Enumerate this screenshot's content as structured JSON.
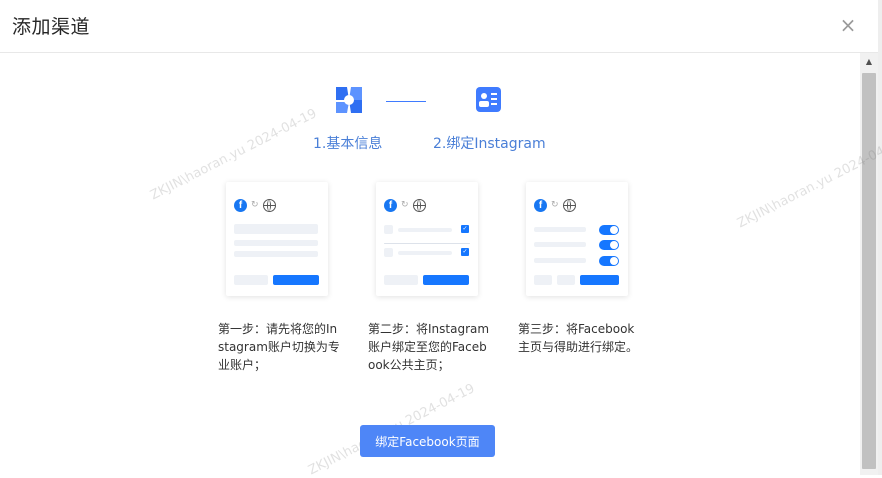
{
  "dialog": {
    "title": "添加渠道",
    "close_glyph": "×"
  },
  "steps": [
    {
      "label": "1.基本信息",
      "icon": "bowtie-shapes-icon"
    },
    {
      "label": "2.绑定Instagram",
      "icon": "profile-card-icon"
    }
  ],
  "cards": [
    {
      "description": "第一步：请先将您的Instagram账户切换为专业账户；"
    },
    {
      "description": "第二步：将Instagram账户绑定至您的Facebook公共主页；"
    },
    {
      "description": "第三步：将Facebook主页与得助进行绑定。"
    }
  ],
  "action": {
    "label": "绑定Facebook页面"
  },
  "watermark": {
    "text": "ZKJIN\\haoran.yu  2024-04-19"
  },
  "colors": {
    "primary": "#4e86f7",
    "step_text": "#4a7fd7",
    "facebook": "#1877f2"
  }
}
